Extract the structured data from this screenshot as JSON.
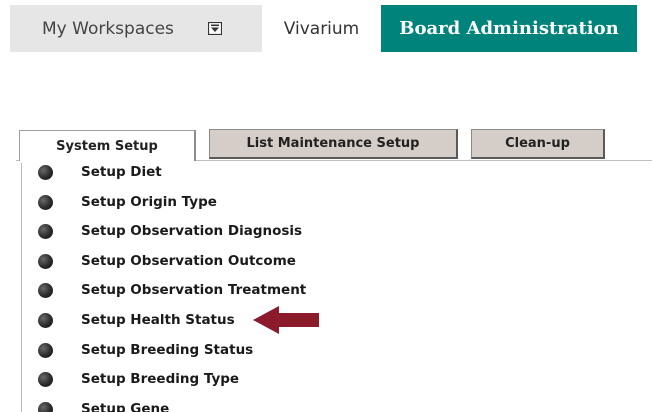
{
  "topnav": {
    "workspaces_label": "My Workspaces",
    "workspaces_icon": "dropdown-box-icon",
    "vivarium_label": "Vivarium",
    "board_label": "Board Administration",
    "board_color": "#00837a"
  },
  "tabs": [
    {
      "label": "System Setup",
      "active": true
    },
    {
      "label": "List Maintenance Setup",
      "active": false
    },
    {
      "label": "Clean-up",
      "active": false
    }
  ],
  "setup_items": [
    {
      "label": "Setup Diet",
      "icon": "bullet-icon"
    },
    {
      "label": "Setup Origin Type",
      "icon": "bullet-icon"
    },
    {
      "label": "Setup Observation Diagnosis",
      "icon": "bullet-icon"
    },
    {
      "label": "Setup Observation Outcome",
      "icon": "bullet-icon"
    },
    {
      "label": "Setup Observation Treatment",
      "icon": "bullet-icon"
    },
    {
      "label": "Setup Health Status",
      "icon": "bullet-icon",
      "highlighted": true
    },
    {
      "label": "Setup Breeding Status",
      "icon": "bullet-icon"
    },
    {
      "label": "Setup Breeding Type",
      "icon": "bullet-icon"
    },
    {
      "label": "Setup Gene",
      "icon": "bullet-icon"
    }
  ],
  "annotation": {
    "icon": "arrow-left-icon",
    "color": "#8b1a2b"
  }
}
